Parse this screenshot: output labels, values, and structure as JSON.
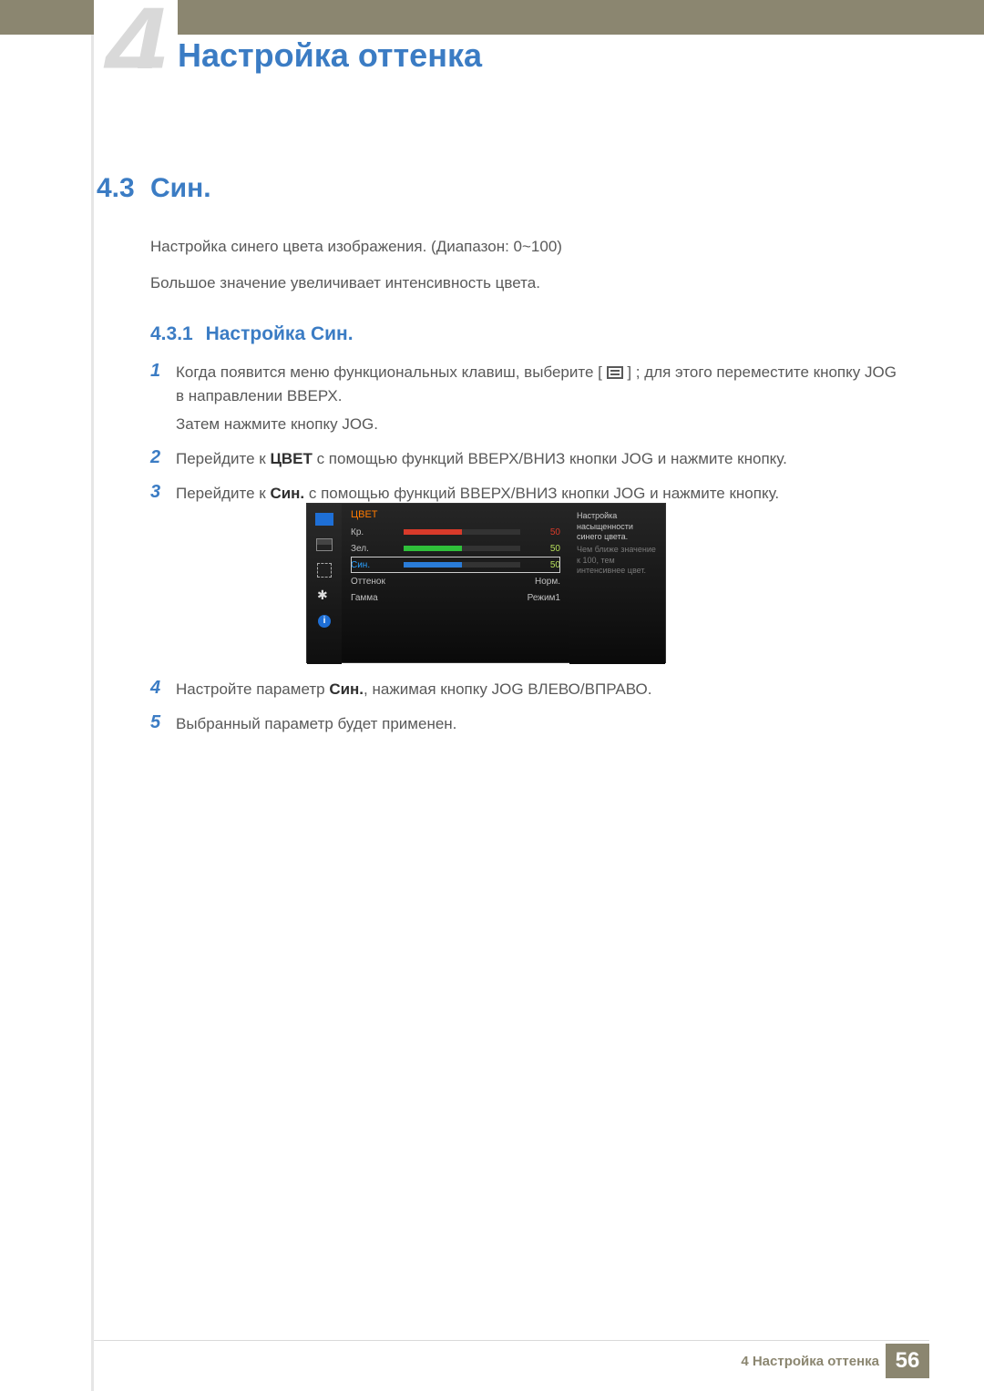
{
  "header": {
    "chapter_number": "4",
    "chapter_title": "Настройка оттенка"
  },
  "section": {
    "number": "4.3",
    "title": "Син."
  },
  "intro": {
    "p1": "Настройка синего цвета изображения. (Диапазон: 0~100)",
    "p2": "Большое значение увеличивает интенсивность цвета."
  },
  "subsection": {
    "number": "4.3.1",
    "title": "Настройка Син."
  },
  "steps": {
    "s1": {
      "num": "1",
      "l1a": "Когда появится меню функциональных клавиш, выберите [",
      "l1b": "] ; для этого переместите кнопку JOG в направлении ВВЕРХ.",
      "l2": "Затем нажмите кнопку JOG."
    },
    "s2": {
      "num": "2",
      "pre": "Перейдите к ",
      "bold": "ЦВЕТ",
      "post": " с помощью функций ВВЕРХ/ВНИЗ кнопки JOG и нажмите кнопку."
    },
    "s3": {
      "num": "3",
      "pre": "Перейдите к ",
      "bold": "Син.",
      "post": " с помощью функций ВВЕРХ/ВНИЗ кнопки JOG и нажмите кнопку."
    },
    "s4": {
      "num": "4",
      "pre": "Настройте параметр ",
      "bold": "Син.",
      "post": ", нажимая кнопку JOG ВЛЕВО/ВПРАВО."
    },
    "s5": {
      "num": "5",
      "text": "Выбранный параметр будет применен."
    }
  },
  "osd": {
    "title": "ЦВЕТ",
    "rows": {
      "red": {
        "label": "Кр.",
        "value": "50"
      },
      "green": {
        "label": "Зел.",
        "value": "50"
      },
      "blue": {
        "label": "Син.",
        "value": "50"
      },
      "tint": {
        "label": "Оттенок",
        "value": "Норм."
      },
      "gamma": {
        "label": "Гамма",
        "value": "Режим1"
      }
    },
    "help": {
      "l1": "Настройка насыщенности синего цвета.",
      "l2": "Чем ближе значение к 100, тем интенсивнее цвет."
    }
  },
  "chart_data": {
    "type": "bar",
    "title": "ЦВЕТ",
    "categories": [
      "Кр.",
      "Зел.",
      "Син."
    ],
    "values": [
      50,
      50,
      50
    ],
    "ylim": [
      0,
      100
    ],
    "series_colors": [
      "#d83a2a",
      "#2fbf3a",
      "#2a7cd8"
    ],
    "extra_rows": [
      {
        "label": "Оттенок",
        "value": "Норм."
      },
      {
        "label": "Гамма",
        "value": "Режим1"
      }
    ],
    "selected_index": 2
  },
  "footer": {
    "chapter_label": "4 Настройка оттенка",
    "page_number": "56"
  }
}
